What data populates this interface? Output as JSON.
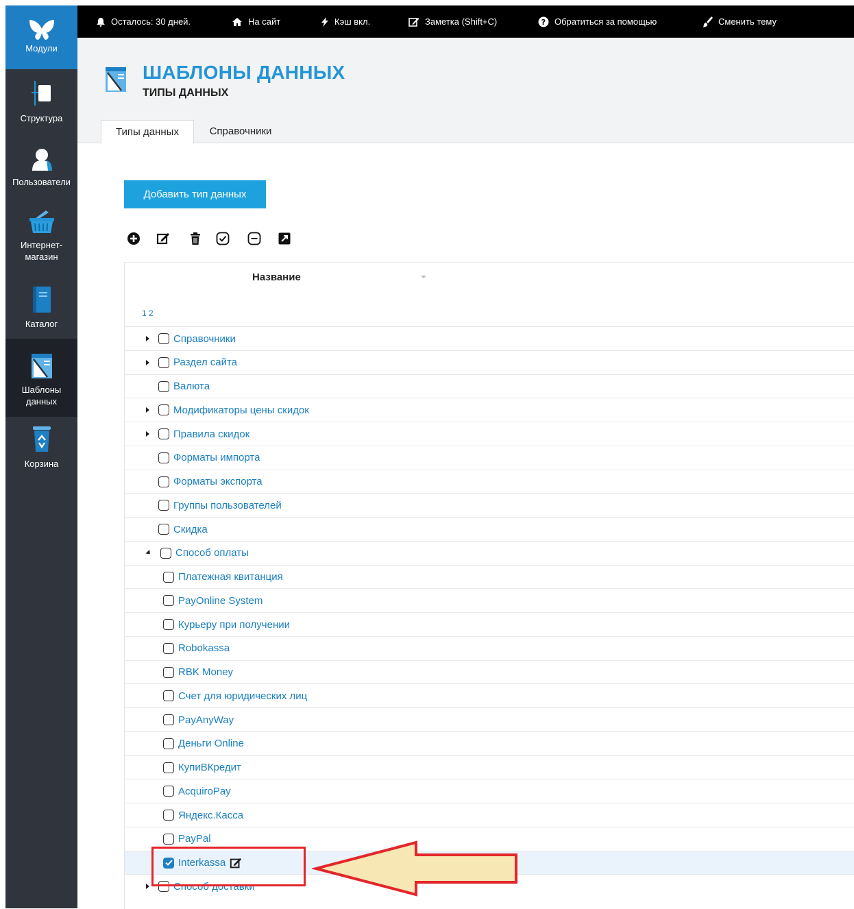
{
  "sidebar": {
    "items": [
      {
        "label": "Модули",
        "icon": "butterfly-icon"
      },
      {
        "label": "Структура",
        "icon": "structure-icon"
      },
      {
        "label": "Пользователи",
        "icon": "user-icon"
      },
      {
        "label": "Интернет-магазин",
        "label_line1": "Интернет-",
        "label_line2": "магазин",
        "icon": "basket-icon"
      },
      {
        "label": "Каталог",
        "icon": "catalog-icon"
      },
      {
        "label": "Шаблоны данных",
        "label_line1": "Шаблоны",
        "label_line2": "данных",
        "icon": "data-templates-icon"
      },
      {
        "label": "Корзина",
        "icon": "recycle-bin-icon"
      }
    ]
  },
  "topbar": {
    "items": [
      {
        "label": "Осталось: 30 дней.",
        "icon": "bell-icon"
      },
      {
        "label": "На сайт",
        "icon": "home-icon"
      },
      {
        "label": "Кэш вкл.",
        "icon": "bolt-icon"
      },
      {
        "label": "Заметка (Shift+C)",
        "icon": "note-edit-icon"
      },
      {
        "label": "Обратиться за помощью",
        "icon": "help-icon"
      },
      {
        "label": "Сменить тему",
        "icon": "brush-icon"
      }
    ]
  },
  "header": {
    "title": "ШАБЛОНЫ ДАННЫХ",
    "subtitle": "ТИПЫ ДАННЫХ",
    "icon": "data-templates-icon"
  },
  "tabs": [
    {
      "label": "Типы данных",
      "active": true
    },
    {
      "label": "Справочники",
      "active": false
    }
  ],
  "actions": {
    "add_button": "Добавить тип данных"
  },
  "toolbar_icons": [
    "add-circle-icon",
    "edit-icon",
    "delete-icon",
    "check-circle-icon",
    "minus-circle-icon",
    "external-link-icon"
  ],
  "table": {
    "column_header": "Название",
    "pager": "1 2",
    "rows": [
      {
        "label": "Справочники",
        "expander": "collapsed",
        "level": 0,
        "checked": false
      },
      {
        "label": "Раздел сайта",
        "expander": "collapsed",
        "level": 0,
        "checked": false
      },
      {
        "label": "Валюта",
        "expander": "none",
        "level": 0,
        "checked": false
      },
      {
        "label": "Модификаторы цены скидок",
        "expander": "collapsed",
        "level": 0,
        "checked": false
      },
      {
        "label": "Правила скидок",
        "expander": "collapsed",
        "level": 0,
        "checked": false
      },
      {
        "label": "Форматы импорта",
        "expander": "none",
        "level": 0,
        "checked": false
      },
      {
        "label": "Форматы экспорта",
        "expander": "none",
        "level": 0,
        "checked": false
      },
      {
        "label": "Группы пользователей",
        "expander": "none",
        "level": 0,
        "checked": false
      },
      {
        "label": "Скидка",
        "expander": "none",
        "level": 0,
        "checked": false
      },
      {
        "label": "Способ оплаты",
        "expander": "expanded",
        "level": 0,
        "checked": false
      },
      {
        "label": "Платежная квитанция",
        "expander": "none",
        "level": 1,
        "checked": false
      },
      {
        "label": "PayOnline System",
        "expander": "none",
        "level": 1,
        "checked": false
      },
      {
        "label": "Курьеру при получении",
        "expander": "none",
        "level": 1,
        "checked": false
      },
      {
        "label": "Robokassa",
        "expander": "none",
        "level": 1,
        "checked": false
      },
      {
        "label": "RBK Money",
        "expander": "none",
        "level": 1,
        "checked": false
      },
      {
        "label": "Счет для юридических лиц",
        "expander": "none",
        "level": 1,
        "checked": false
      },
      {
        "label": "PayAnyWay",
        "expander": "none",
        "level": 1,
        "checked": false
      },
      {
        "label": "Деньги Online",
        "expander": "none",
        "level": 1,
        "checked": false
      },
      {
        "label": "КупиВКредит",
        "expander": "none",
        "level": 1,
        "checked": false
      },
      {
        "label": "AcquiroPay",
        "expander": "none",
        "level": 1,
        "checked": false
      },
      {
        "label": "Яндекс.Касса",
        "expander": "none",
        "level": 1,
        "checked": false
      },
      {
        "label": "PayPal",
        "expander": "none",
        "level": 1,
        "checked": false
      },
      {
        "label": "Interkassa",
        "expander": "none",
        "level": 1,
        "checked": true,
        "selected": true
      },
      {
        "label": "Способ доставки",
        "expander": "collapsed",
        "level": 0,
        "checked": false
      }
    ]
  },
  "colors": {
    "accent": "#1da2de",
    "sidebar_bg": "#30353d",
    "sidebar_active": "#1f7fc4",
    "link": "#1a7fc1",
    "annotation_red": "#e3262b",
    "annotation_fill": "#f7e7b5"
  }
}
